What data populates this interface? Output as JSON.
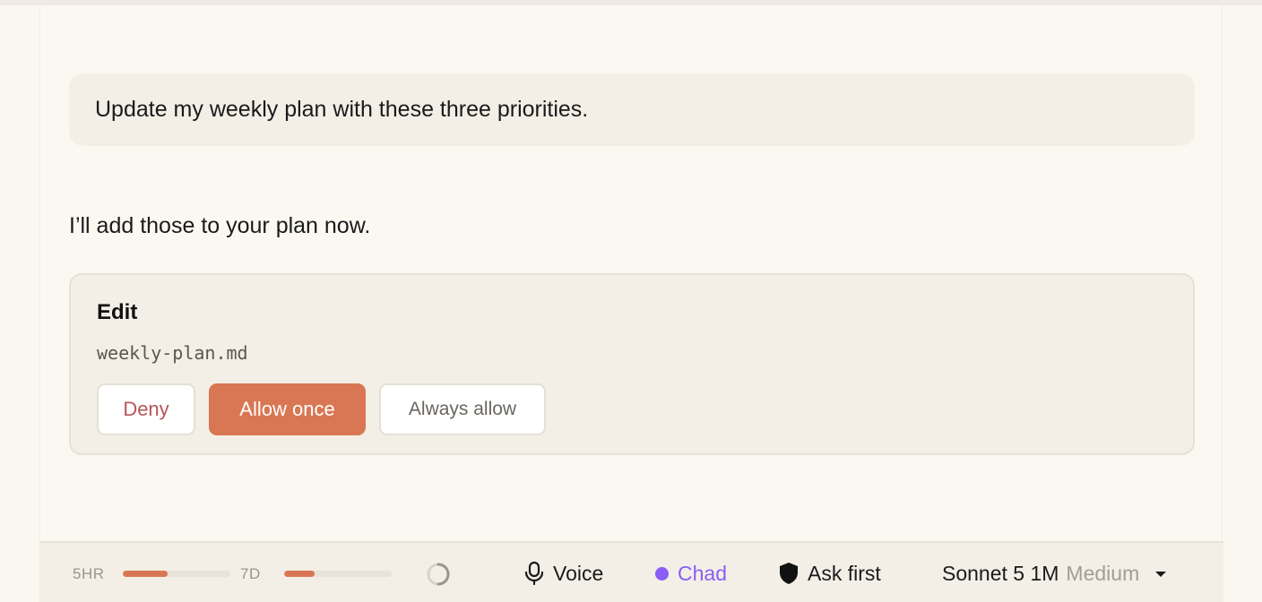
{
  "conversation": {
    "user_message": "Update my weekly plan with these three priorities.",
    "assistant_message": "I’ll add those to your plan now."
  },
  "permission": {
    "title": "Edit",
    "file": "weekly-plan.md",
    "deny_label": "Deny",
    "allow_once_label": "Allow once",
    "always_allow_label": "Always allow"
  },
  "footer": {
    "usage": [
      {
        "label": "5HR",
        "fraction": 0.42
      },
      {
        "label": "7D",
        "fraction": 0.28
      }
    ],
    "voice_label": "Voice",
    "user_name": "Chad",
    "mode_label": "Ask first",
    "model_name": "Sonnet 5 1M",
    "model_effort": "Medium"
  },
  "colors": {
    "accent": "#d97653",
    "deny_text": "#b8545a",
    "user_dot": "#8b5cf6"
  },
  "icons": {
    "voice": "microphone-icon",
    "mode": "shield-icon",
    "model": "chevron-down-icon",
    "status": "loading-spinner-icon"
  }
}
